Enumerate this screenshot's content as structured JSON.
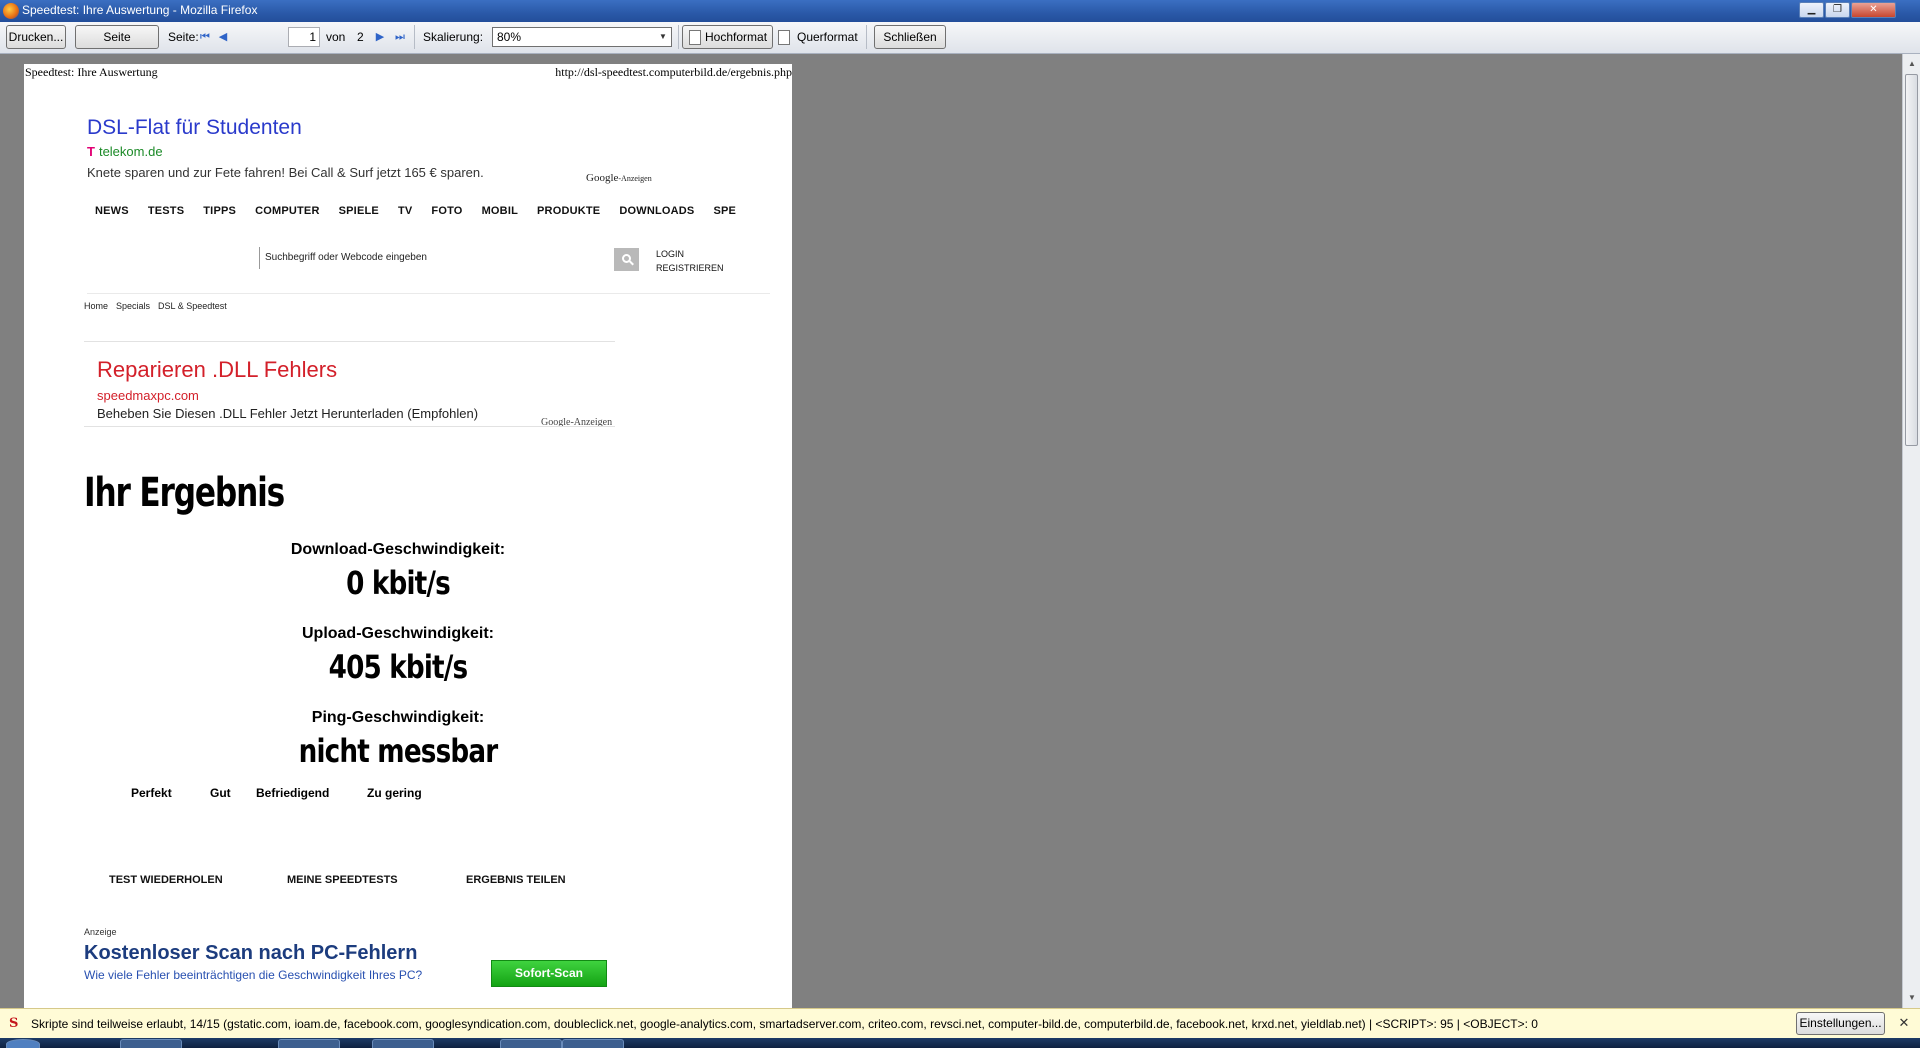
{
  "window": {
    "title": "Speedtest: Ihre Auswertung - Mozilla Firefox"
  },
  "toolbar": {
    "print_label": "Drucken...",
    "page_setup_label": "Seite einrichten...",
    "page_label": "Seite:",
    "page_current": "1",
    "page_of_label": "von",
    "page_total": "2",
    "scale_label": "Skalierung:",
    "scale_value": "80%",
    "portrait_label": "Hochformat",
    "landscape_label": "Querformat",
    "close_label": "Schließen"
  },
  "page": {
    "header_left": "Speedtest: Ihre Auswertung",
    "header_right": "http://dsl-speedtest.computerbild.de/ergebnis.php",
    "ad1": {
      "title": "DSL-Flat für Studenten",
      "url": "telekom.de",
      "logo_text": "T",
      "description": "Knete sparen und zur Fete fahren! Bei Call & Surf jetzt 165 € sparen.",
      "google_label": "Google",
      "google_suffix": "-Anzeigen"
    },
    "nav": [
      "NEWS",
      "TESTS",
      "TIPPS",
      "COMPUTER",
      "SPIELE",
      "TV",
      "FOTO",
      "MOBIL",
      "PRODUKTE",
      "DOWNLOADS",
      "SPE"
    ],
    "search": {
      "placeholder": "Suchbegriff oder Webcode eingeben"
    },
    "login_label": "LOGIN",
    "register_label": "REGISTRIEREN",
    "breadcrumb": [
      "Home",
      "Specials",
      "DSL & Speedtest"
    ],
    "ad2": {
      "title": "Reparieren .DLL Fehlers",
      "url": "speedmaxpc.com",
      "description": "Beheben Sie Diesen .DLL Fehler Jetzt Herunterladen (Empfohlen)",
      "google_label": "Google-Anzeigen"
    },
    "result": {
      "heading": "Ihr Ergebnis",
      "download_label": "Download-Geschwindigkeit:",
      "download_value": "0 kbit/s",
      "upload_label": "Upload-Geschwindigkeit:",
      "upload_value": "405 kbit/s",
      "ping_label": "Ping-Geschwindigkeit:",
      "ping_value": "nicht messbar"
    },
    "rating_scale": [
      "Perfekt",
      "Gut",
      "Befriedigend",
      "Zu gering"
    ],
    "actions": {
      "repeat": "TEST WIEDERHOLEN",
      "my_tests": "MEINE SPEEDTESTS",
      "share": "ERGEBNIS TEILEN"
    },
    "ad3": {
      "label": "Anzeige",
      "title": "Kostenloser Scan nach PC-Fehlern",
      "description": "Wie viele Fehler beeinträchtigen die Geschwindigkeit Ihres PC?",
      "button": "Sofort-Scan"
    }
  },
  "noscript": {
    "message": "Skripte sind teilweise erlaubt, 14/15 (gstatic.com, ioam.de, facebook.com, googlesyndication.com, doubleclick.net, google-analytics.com, smartadserver.com, criteo.com, revsci.net, computer-bild.de, computerbild.de, facebook.net, krxd.net, yieldlab.net) | <SCRIPT>: 95 | <OBJECT>: 0",
    "settings_label": "Einstellungen..."
  },
  "colors": {
    "ad1_title": "#2a3acb",
    "ad1_url": "#1b8a27",
    "telekom_magenta": "#e20074",
    "ad2_red": "#d3202a",
    "ad3_title": "#1c3c7e",
    "sofort_green": "#14a314",
    "preview_bg": "#808080",
    "noscript_bg": "#fffbd6"
  },
  "icons": {
    "app": "firefox-icon",
    "first": "first-page-icon",
    "prev": "prev-page-icon",
    "next": "next-page-icon",
    "last": "last-page-icon",
    "search": "magnifier-icon",
    "noscript": "noscript-icon",
    "close": "close-icon"
  }
}
